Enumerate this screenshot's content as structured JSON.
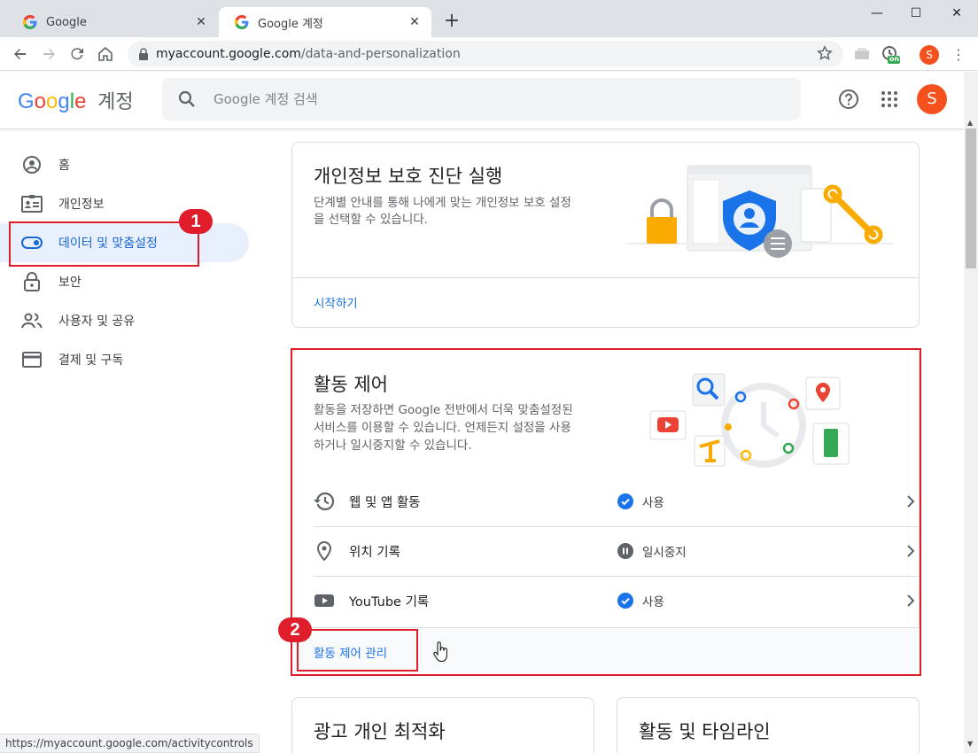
{
  "browser": {
    "tabs": [
      {
        "title": "Google",
        "favicon": "google-g-icon",
        "active": false
      },
      {
        "title": "Google 계정",
        "favicon": "google-g-icon",
        "active": true
      }
    ],
    "new_tab_label": "+",
    "window_controls": [
      "minimize-icon",
      "maximize-icon",
      "close-icon"
    ],
    "url": {
      "host": "myaccount.google.com",
      "path": "/data-and-personalization"
    },
    "profile_initial": "S",
    "extension_badge": "on",
    "status_url": "https://myaccount.google.com/activitycontrols"
  },
  "header": {
    "logo_letters": [
      {
        "ch": "G",
        "color": "#4285f4"
      },
      {
        "ch": "o",
        "color": "#ea4335"
      },
      {
        "ch": "o",
        "color": "#fbbc05"
      },
      {
        "ch": "g",
        "color": "#4285f4"
      },
      {
        "ch": "l",
        "color": "#34a853"
      },
      {
        "ch": "e",
        "color": "#ea4335"
      }
    ],
    "logo_suffix": "계정",
    "search_placeholder": "Google 계정 검색",
    "avatar_initial": "S",
    "avatar_color": "#f4511e"
  },
  "sidebar": {
    "items": [
      {
        "label": "홈",
        "icon": "account-circle-icon",
        "active": false
      },
      {
        "label": "개인정보",
        "icon": "id-card-icon",
        "active": false
      },
      {
        "label": "데이터 및 맞춤설정",
        "icon": "toggle-icon",
        "active": true
      },
      {
        "label": "보안",
        "icon": "lock-icon",
        "active": false
      },
      {
        "label": "사용자 및 공유",
        "icon": "people-icon",
        "active": false
      },
      {
        "label": "결제 및 구독",
        "icon": "credit-card-icon",
        "active": false
      }
    ]
  },
  "privacy_card": {
    "title": "개인정보 보호 진단 실행",
    "description_line1": "단계별 안내를 통해 나에게 맞는 개인정보 보호 설정",
    "description_line2": "을 선택할 수 있습니다.",
    "action": "시작하기"
  },
  "activity_card": {
    "title": "활동 제어",
    "description_line1": "활동을 저장하면 Google 전반에서 더욱 맞춤설정된",
    "description_line2": "서비스를 이용할 수 있습니다. 언제든지 설정을 사용",
    "description_line3": "하거나 일시중지할 수 있습니다.",
    "rows": [
      {
        "label": "웹 및 앱 활동",
        "icon": "history-icon",
        "status": "사용",
        "status_icon": "check-circle-icon"
      },
      {
        "label": "위치 기록",
        "icon": "location-pin-icon",
        "status": "일시중지",
        "status_icon": "pause-circle-icon"
      },
      {
        "label": "YouTube 기록",
        "icon": "youtube-icon",
        "status": "사용",
        "status_icon": "check-circle-icon"
      }
    ],
    "action": "활동 제어 관리"
  },
  "bottom_cards": {
    "ads_title": "광고 개인 최적화",
    "timeline_title": "활동 및 타임라인"
  },
  "annotations": {
    "badge1": "1",
    "badge2": "2",
    "color": "#e01e2b"
  },
  "colors": {
    "link_blue": "#1a73e8",
    "active_bg": "#e8f0fe",
    "active_text": "#1967d2"
  }
}
